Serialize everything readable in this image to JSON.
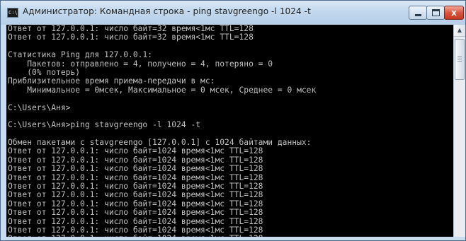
{
  "window": {
    "title": "Администратор: Командная строка - ping  stavgreengo -l 1024 -t",
    "icon": "cmd-icon",
    "icon_text": "C:\\",
    "close_glyph": "x"
  },
  "console": {
    "lines": [
      "Ответ от 127.0.0.1: число байт=32 время<1мс TTL=128",
      "Ответ от 127.0.0.1: число байт=32 время<1мс TTL=128",
      "",
      "Статистика Ping для 127.0.0.1:",
      "    Пакетов: отправлено = 4, получено = 4, потеряно = 0",
      "    (0% потерь)",
      "Приблизительное время приема-передачи в мс:",
      "    Минимальное = 0мсек, Максимальное = 0 мсек, Среднее = 0 мсек",
      "",
      "C:\\Users\\Аня>",
      "",
      "C:\\Users\\Аня>ping stavgreengo -l 1024 -t",
      "",
      "Обмен пакетами с stavgreengo [127.0.0.1] с 1024 байтами данных:",
      "Ответ от 127.0.0.1: число байт=1024 время<1мс TTL=128",
      "Ответ от 127.0.0.1: число байт=1024 время<1мс TTL=128",
      "Ответ от 127.0.0.1: число байт=1024 время<1мс TTL=128",
      "Ответ от 127.0.0.1: число байт=1024 время<1мс TTL=128",
      "Ответ от 127.0.0.1: число байт=1024 время<1мс TTL=128",
      "Ответ от 127.0.0.1: число байт=1024 время<1мс TTL=128",
      "Ответ от 127.0.0.1: число байт=1024 время<1мс TTL=128",
      "Ответ от 127.0.0.1: число байт=1024 время<1мс TTL=128",
      "Ответ от 127.0.0.1: число байт=1024 время<1мс TTL=128",
      "Ответ от 127.0.0.1: число байт=1024 время<1мс TTL=128",
      "Ответ от 127.0.0.1: число байт=1024 время<1мс TTL=128"
    ]
  },
  "colors": {
    "console_background": "#000000",
    "console_text": "#c0c0c0",
    "close_button": "#c43a22"
  }
}
